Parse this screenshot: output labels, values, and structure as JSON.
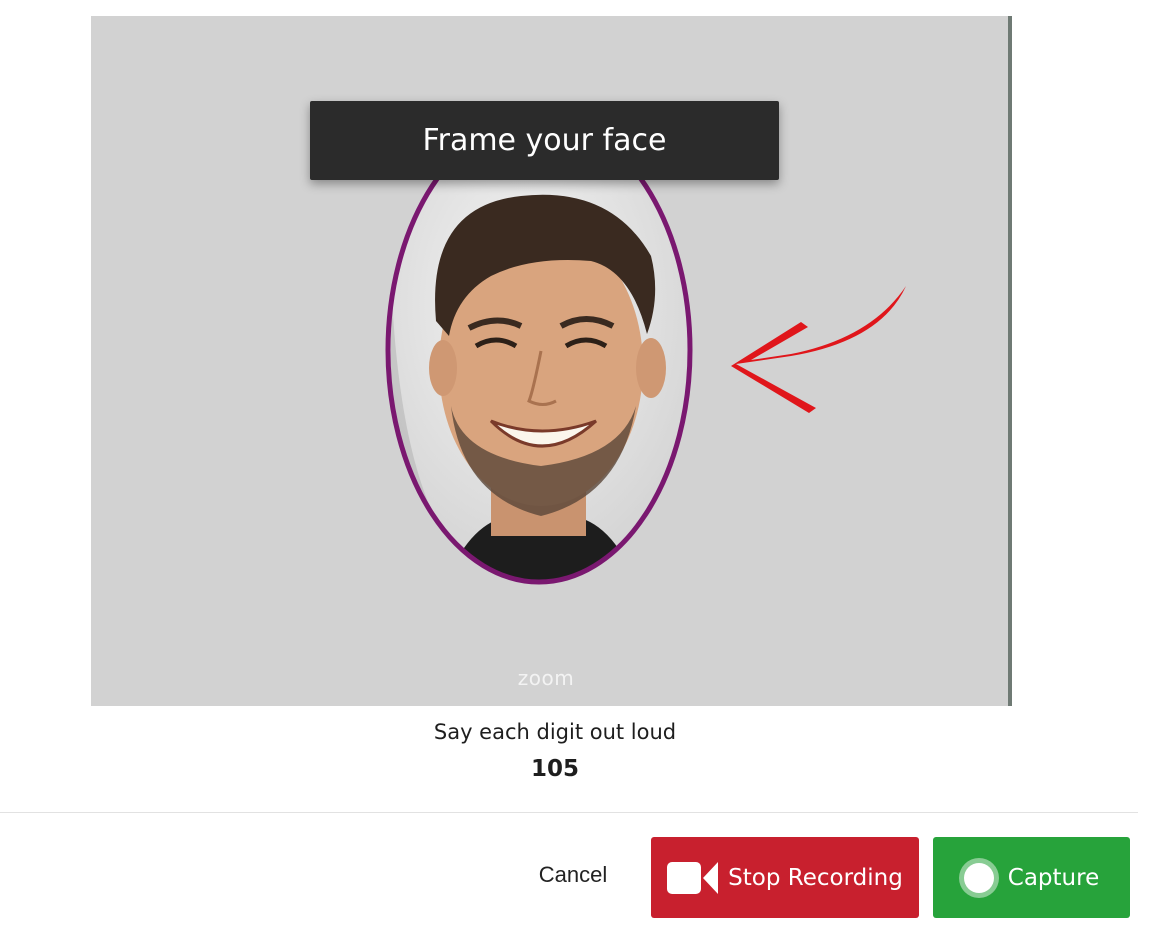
{
  "video": {
    "banner_text": "Frame your face",
    "watermark": "zoom",
    "colors": {
      "background": "#d2d2d2",
      "oval_border": "#7a1870",
      "arrow": "#e0161b"
    }
  },
  "prompt": {
    "instruction": "Say each digit out loud",
    "digits": "105"
  },
  "actions": {
    "cancel_label": "Cancel",
    "stop_label": "Stop Recording",
    "capture_label": "Capture",
    "stop_icon": "video-camera-icon",
    "capture_icon": "record-dot-icon",
    "colors": {
      "stop": "#c8202e",
      "capture": "#27a33b"
    }
  }
}
